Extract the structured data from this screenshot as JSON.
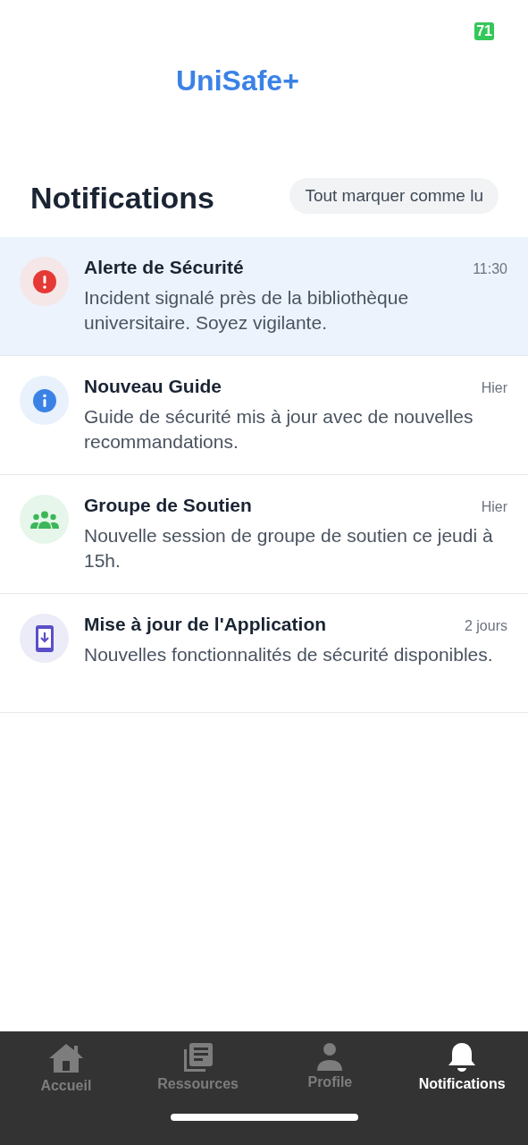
{
  "status_bar": {
    "battery": "71"
  },
  "app": {
    "logo": "UniSafe+"
  },
  "header": {
    "title": "Notifications",
    "mark_all_button": "Tout marquer comme lu"
  },
  "notifications": [
    {
      "kind": "alert",
      "title": "Alerte de Sécurité",
      "message": "Incident signalé près de la bibliothèque universitaire. Soyez vigilante.",
      "time": "11:30",
      "unread": true,
      "color": "#e53935"
    },
    {
      "kind": "info",
      "title": "Nouveau Guide",
      "message": "Guide de sécurité mis à jour avec de nouvelles recommandations.",
      "time": "Hier",
      "unread": false,
      "color": "#3b82e6"
    },
    {
      "kind": "group",
      "title": "Groupe de Soutien",
      "message": "Nouvelle session de groupe de soutien ce jeudi à 15h.",
      "time": "Hier",
      "unread": false,
      "color": "#3cb65a"
    },
    {
      "kind": "update",
      "title": "Mise à jour de l'Application",
      "message": "Nouvelles fonctionnalités de sécurité disponibles.",
      "time": "2 jours",
      "unread": false,
      "color": "#5a4fc8"
    }
  ],
  "tab_bar": [
    {
      "kind": "home",
      "label": "Accueil",
      "selected": false
    },
    {
      "kind": "resources",
      "label": "Ressources",
      "selected": false
    },
    {
      "kind": "profile",
      "label": "Profile",
      "selected": false
    },
    {
      "kind": "notifications",
      "label": "Notifications",
      "selected": true
    }
  ]
}
